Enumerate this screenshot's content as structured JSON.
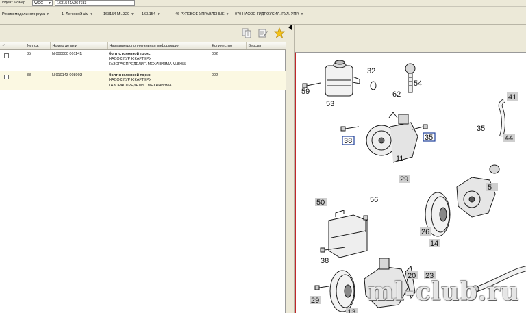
{
  "ident": {
    "label": "Идент. номер",
    "prefix": "WDC",
    "value": "1631541A264783"
  },
  "model_bar": {
    "items": [
      "Режим модельного ряда",
      "1. Легковой а/м",
      "163154 ML 320",
      "163.154",
      "46 РУЛЕВОЕ УПРАВЛЕНИЕ",
      "070 НАСОС ГИДРОУСИЛ. РУЛ. УПР."
    ]
  },
  "table": {
    "columns": [
      "✓",
      "№ поз.",
      "Номер детали",
      "Название/дополнительная информация",
      "Количество",
      "Версия"
    ],
    "rows": [
      {
        "pos": "35",
        "part": "N 000000 001141",
        "title": "болт с головкой торкс",
        "lines": [
          "НАСОС ГУР К КАРТЕРУ",
          "ГАЗОРАСПРЕДЕЛИТ. МЕХАНИЗМА M.8X55"
        ],
        "qty": "002",
        "version": ""
      },
      {
        "pos": "38",
        "part": "N 910143 008003",
        "title": "болт с головкой торкс",
        "lines": [
          "НАСОС ГУР К КАРТЕРУ",
          "ГАЗОРАСПРЕДЕЛИТ. МЕХАНИЗМА"
        ],
        "qty": "002",
        "version": ""
      }
    ]
  },
  "diagram": {
    "labels": [
      "59",
      "53",
      "32",
      "62",
      "54",
      "41",
      "35",
      "44",
      "38",
      "35",
      "11",
      "5",
      "29",
      "14",
      "50",
      "56",
      "38",
      "26",
      "20",
      "23",
      "29",
      "13"
    ],
    "boxed_labels": [
      "38",
      "35"
    ]
  },
  "watermark": "ml-club.ru",
  "icons": [
    "copy-icon",
    "edit-note-icon",
    "favorite-star-icon"
  ],
  "colors": {
    "accent_border": "#c0282a",
    "selected_row": "#fbf8e2",
    "window_bg": "#ece9d8"
  }
}
